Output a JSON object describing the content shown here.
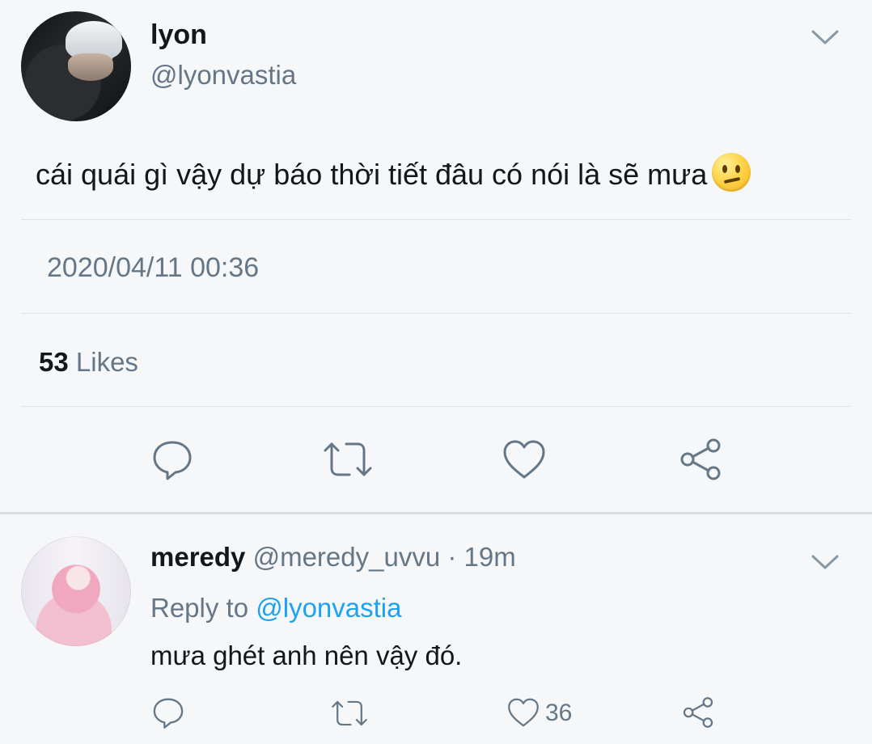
{
  "tweet": {
    "display_name": "lyon",
    "handle": "@lyonvastia",
    "text": "cái quái gì vậy dự báo thời tiết đâu có nói là sẽ mưa",
    "timestamp": "2020/04/11 00:36",
    "likes_count": "53",
    "likes_label": "Likes",
    "icons": [
      "reply-icon",
      "retweet-icon",
      "like-icon",
      "share-icon"
    ]
  },
  "reply": {
    "display_name": "meredy",
    "handle_time": "@meredy_uvvu · 19m",
    "reply_to_label": "Reply to",
    "reply_to_handle": "@lyonvastia",
    "text": "mưa ghét anh nên vậy đó.",
    "like_count": "36"
  },
  "colors": {
    "background": "#f5f7f9",
    "secondary_text": "#657786",
    "link": "#1da1f2"
  }
}
